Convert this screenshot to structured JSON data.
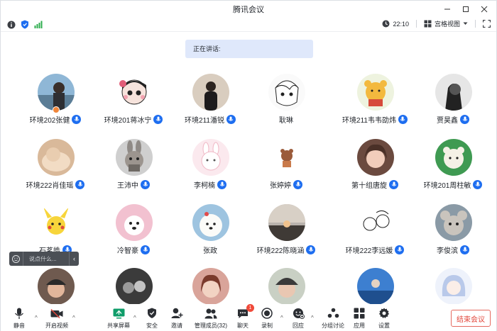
{
  "window": {
    "title": "腾讯会议"
  },
  "infobar": {
    "time": "22:10",
    "view_label": "宫格视图"
  },
  "speaking_label": "正在讲话:",
  "participants": [
    {
      "name": "环境202张健",
      "mic": true,
      "host": true,
      "avatar": "avatar-boy-beach"
    },
    {
      "name": "环境201蒋冰宁",
      "mic": true,
      "avatar": "avatar-cartoon-girl"
    },
    {
      "name": "环境211潘锐",
      "mic": true,
      "avatar": "avatar-person-dark"
    },
    {
      "name": "耿琳",
      "mic": false,
      "avatar": "avatar-anime-sketch"
    },
    {
      "name": "环境211韦韦劭炜",
      "mic": true,
      "avatar": "avatar-winnie-bear"
    },
    {
      "name": "贾昊鑫",
      "mic": true,
      "avatar": "avatar-bw-portrait"
    },
    {
      "name": "环境222肖佳瑶",
      "mic": true,
      "avatar": "avatar-cat"
    },
    {
      "name": "王沛中",
      "mic": true,
      "avatar": "avatar-rabbit"
    },
    {
      "name": "李柯楠",
      "mic": true,
      "avatar": "avatar-pink-bunny"
    },
    {
      "name": "张婷婷",
      "mic": true,
      "avatar": "avatar-small-bear"
    },
    {
      "name": "第十组唐旋",
      "mic": true,
      "avatar": "avatar-girl-photo"
    },
    {
      "name": "环境201周柱敏",
      "mic": true,
      "avatar": "avatar-green-bear"
    },
    {
      "name": "石茗皓",
      "mic": true,
      "avatar": "avatar-pikachu"
    },
    {
      "name": "冷智豪",
      "mic": true,
      "avatar": "avatar-dog-pink"
    },
    {
      "name": "张政",
      "mic": false,
      "avatar": "avatar-samoyed"
    },
    {
      "name": "环境222陈晓涵",
      "mic": true,
      "avatar": "avatar-sunset"
    },
    {
      "name": "环境222李远媛",
      "mic": true,
      "avatar": "avatar-comic"
    },
    {
      "name": "李俊滨",
      "mic": true,
      "avatar": "avatar-mouse-cartoon"
    },
    {
      "name": "",
      "mic": false,
      "avatar": "avatar-cap-boy"
    },
    {
      "name": "",
      "mic": false,
      "avatar": "avatar-bw-group"
    },
    {
      "name": "",
      "mic": false,
      "avatar": "avatar-girl-red"
    },
    {
      "name": "",
      "mic": false,
      "avatar": "avatar-boy-hat"
    },
    {
      "name": "",
      "mic": false,
      "avatar": "avatar-blue-scene"
    },
    {
      "name": "",
      "mic": false,
      "avatar": "avatar-anime-blue"
    }
  ],
  "chat": {
    "placeholder": "说点什么..."
  },
  "toolbar": {
    "mute": "静音",
    "video": "开启视频",
    "share": "共享屏幕",
    "security": "安全",
    "invite": "邀请",
    "members": "管理成员(32)",
    "chat": "聊天",
    "chat_badge": "1",
    "record": "录制",
    "reaction": "回应",
    "breakout": "分组讨论",
    "apps": "应用",
    "settings": "设置",
    "end": "结束会议"
  },
  "colors": {
    "accent": "#1e6ef0",
    "end": "#e2473b",
    "speaking_bg": "#dfe8fb"
  }
}
